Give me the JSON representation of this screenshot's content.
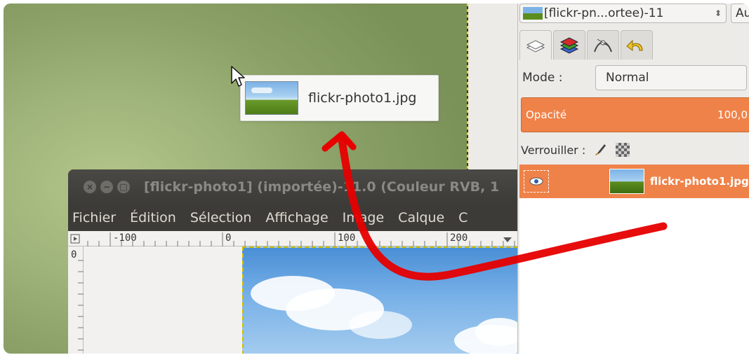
{
  "drag_tooltip": {
    "filename": "flickr-photo1.jpg",
    "thumbnail_icon": "landscape-thumbnail"
  },
  "image_window": {
    "title": "[flickr-photo1] (importée)-11.0 (Couleur RVB, 1",
    "menu": [
      "Fichier",
      "Édition",
      "Sélection",
      "Affichage",
      "Image",
      "Calque",
      "C"
    ],
    "ruler_labels": [
      "-100",
      "0",
      "100",
      "200"
    ],
    "vruler_label": "0"
  },
  "layers_dock": {
    "image_select": "[flickr-pn...ortee)-11",
    "auto_button": "Au",
    "tabs": [
      "layers-icon",
      "channels-icon",
      "paths-icon",
      "undo-history-icon"
    ],
    "mode_label": "Mode :",
    "mode_value": "Normal",
    "opacity_label": "Opacité",
    "opacity_value": "100,0",
    "lock_label": "Verrouiller :",
    "layer_name": "flickr-photo1.jpg"
  },
  "colors": {
    "accent_orange": "#ef8249",
    "arrow_red": "#e60000"
  }
}
